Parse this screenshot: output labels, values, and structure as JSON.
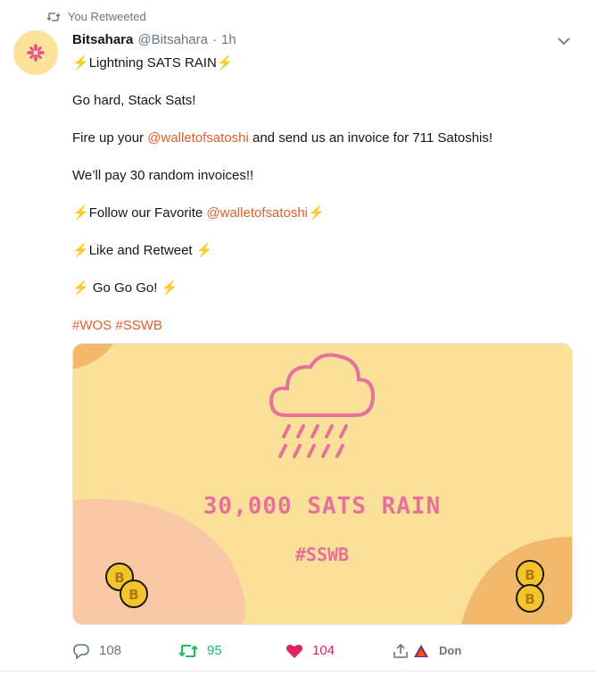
{
  "retweet_banner": {
    "label": "You Retweeted"
  },
  "author": {
    "name": "Bitsahara",
    "handle": "@Bitsahara",
    "separator": "·",
    "time": "1h"
  },
  "tweet": {
    "line1_bolt_left": "⚡",
    "line1_text": "Lightning SATS RAIN",
    "line1_bolt_right": "⚡",
    "line2": "Go hard, Stack Sats!",
    "line3_pre": "Fire up your ",
    "line3_mention": "@walletofsatoshi",
    "line3_post": " and send us an invoice for 711 Satoshis!",
    "line4": "We’ll pay 30 random invoices!!",
    "line5_bolt_left": "⚡",
    "line5_text": "Follow our Favorite ",
    "line5_mention": "@walletofsatoshi",
    "line5_bolt_right": "⚡",
    "line6_bolt_left": "⚡",
    "line6_text": "Like and Retweet ",
    "line6_bolt_right": "⚡",
    "line7_bolt_left": "⚡",
    "line7_text": " Go Go Go! ",
    "line7_bolt_right": "⚡",
    "hashtags": [
      "#WOS",
      "#SSWB"
    ]
  },
  "media": {
    "headline": "30,000 SATS RAIN",
    "hashtag": "#SSWB",
    "colors": {
      "background": "#fbe09a",
      "accent": "#e6719a",
      "corner": "#f2b96c",
      "blob": "#f8c9a4"
    }
  },
  "actions": {
    "reply_count": "108",
    "retweet_count": "95",
    "like_count": "104",
    "share_extra_label": "Don",
    "colors": {
      "retweet": "#17bf63",
      "like": "#e0245e",
      "neutral": "#657786"
    }
  },
  "icons": [
    "retweet-icon",
    "avatar-logo-icon",
    "chevron-down-icon",
    "reply-icon",
    "retweet-icon",
    "heart-icon",
    "share-icon",
    "brave-triangle-icon"
  ]
}
